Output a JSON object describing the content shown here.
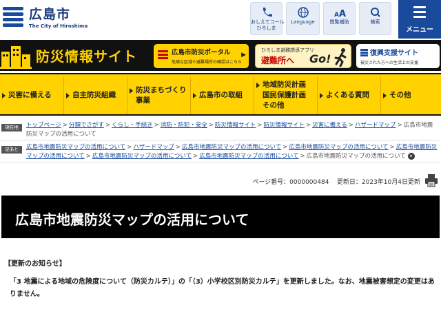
{
  "header": {
    "logo_name": "広島市",
    "logo_sub": "The City of Hiroshima",
    "tools": [
      {
        "label_1": "おしえてコール",
        "label_2": "ひろしま",
        "icon": "phone-icon"
      },
      {
        "label_1": "Language",
        "label_2": "",
        "icon": "globe-icon"
      },
      {
        "label_1": "閲覧補助",
        "label_2": "",
        "icon": "text-size-icon"
      },
      {
        "label_1": "検索",
        "label_2": "",
        "icon": "search-icon"
      }
    ],
    "menu_label": "メニュー"
  },
  "banner": {
    "site_title": "防災情報サイト",
    "portal_title": "広島市防災ポータル",
    "portal_sub": "危険な区域や避難場所の確認はこちら",
    "app_sub": "ひろしま避難誘導アプリ",
    "app_title": "避難所へ",
    "app_go": "Go!",
    "recovery_title": "復興支援サイト",
    "recovery_sub": "被災された方への生活上の支援"
  },
  "nav": [
    {
      "line1": "災害に備える",
      "line2": "",
      "line3": ""
    },
    {
      "line1": "自主防災組織",
      "line2": "",
      "line3": ""
    },
    {
      "line1": "防災まちづくり",
      "line2": "事業",
      "line3": ""
    },
    {
      "line1": "広島市の取組",
      "line2": "",
      "line3": ""
    },
    {
      "line1": "地域防災計画",
      "line2": "国民保護計画",
      "line3": "その他"
    },
    {
      "line1": "よくある質問",
      "line2": "",
      "line3": ""
    },
    {
      "line1": "その他",
      "line2": "",
      "line3": ""
    }
  ],
  "breadcrumb_current": {
    "tag": "現在地",
    "links": [
      "トップページ",
      "分類でさがす",
      "くらし・手続き",
      "消防・防犯・安全",
      "防災情報サイト",
      "防災情報サイト",
      "災害に備える",
      "ハザードマップ"
    ],
    "current": "広島市地震防災マップの活用について"
  },
  "breadcrumb_history": {
    "tag": "足あと",
    "links": [
      "広島市地震防災マップの活用について",
      "ハザードマップ",
      "広島市地震防災マップの活用について",
      "広島市地震防災マップの活用について",
      "広島市地震防災マップの活用について",
      "広島市地震防災マップの活用について",
      "広島市地震防災マップの活用について"
    ],
    "current": "広島市地震防災マップの活用について"
  },
  "meta": {
    "page_number": "ページ番号：0000000484",
    "updated": "更新日：2023年10月4日更新"
  },
  "page_title": "広島市地震防災マップの活用について",
  "notice": {
    "heading": "【更新のお知らせ】",
    "body": "「3 地震による地域の危険度について（防災カルテ）」の「（3）小学校区別防災カルテ」を更新しました。なお、地震被害想定の変更はありません。"
  },
  "colors": {
    "brand_blue": "#1a4a9c",
    "accent_yellow": "#ffd200",
    "banner_black": "#111111"
  }
}
